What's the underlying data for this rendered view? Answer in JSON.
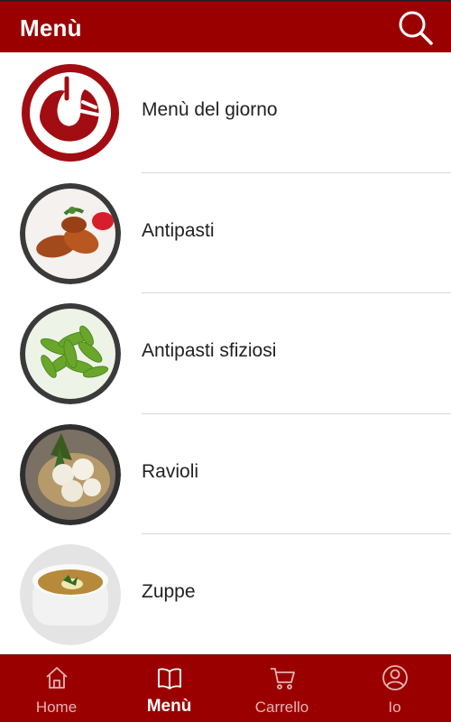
{
  "header": {
    "title": "Menù",
    "search_icon": "search-icon"
  },
  "menu": {
    "items": [
      {
        "label": "Menù del giorno",
        "icon": "restaurant-logo"
      },
      {
        "label": "Antipasti",
        "icon": "fried-appetizer-photo"
      },
      {
        "label": "Antipasti sfiziosi",
        "icon": "edamame-photo"
      },
      {
        "label": "Ravioli",
        "icon": "dumplings-photo"
      },
      {
        "label": "Zuppe",
        "icon": "soup-photo"
      }
    ]
  },
  "tabbar": {
    "tabs": [
      {
        "label": "Home",
        "icon": "home-icon",
        "active": false
      },
      {
        "label": "Menù",
        "icon": "book-icon",
        "active": true
      },
      {
        "label": "Carrello",
        "icon": "cart-icon",
        "active": false
      },
      {
        "label": "Io",
        "icon": "user-icon",
        "active": false
      }
    ]
  },
  "colors": {
    "brand": "#9b0000",
    "tab_inactive": "#e7b3b3",
    "tab_active": "#ffffff"
  }
}
